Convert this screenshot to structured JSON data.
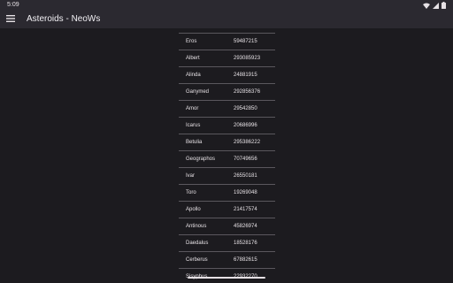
{
  "status": {
    "time": "5:09"
  },
  "app": {
    "title": "Asteroids - NeoWs"
  },
  "icons": {
    "menu": "menu-icon",
    "wifi": "wifi-icon",
    "signal": "signal-icon",
    "battery": "battery-icon"
  },
  "asteroids": [
    {
      "name": "Eros",
      "value": "59487215"
    },
    {
      "name": "Albert",
      "value": "293085923"
    },
    {
      "name": "Alinda",
      "value": "24881915"
    },
    {
      "name": "Ganymed",
      "value": "292856376"
    },
    {
      "name": "Amor",
      "value": "29542850"
    },
    {
      "name": "Icarus",
      "value": "20686996"
    },
    {
      "name": "Betulia",
      "value": "295386222"
    },
    {
      "name": "Geographos",
      "value": "70749656"
    },
    {
      "name": "Ivar",
      "value": "26550181"
    },
    {
      "name": "Toro",
      "value": "19269048"
    },
    {
      "name": "Apollo",
      "value": "21417574"
    },
    {
      "name": "Antinous",
      "value": "45826974"
    },
    {
      "name": "Daedalus",
      "value": "18528176"
    },
    {
      "name": "Cerberus",
      "value": "67882615"
    },
    {
      "name": "Sisyphus",
      "value": "22932270"
    }
  ]
}
